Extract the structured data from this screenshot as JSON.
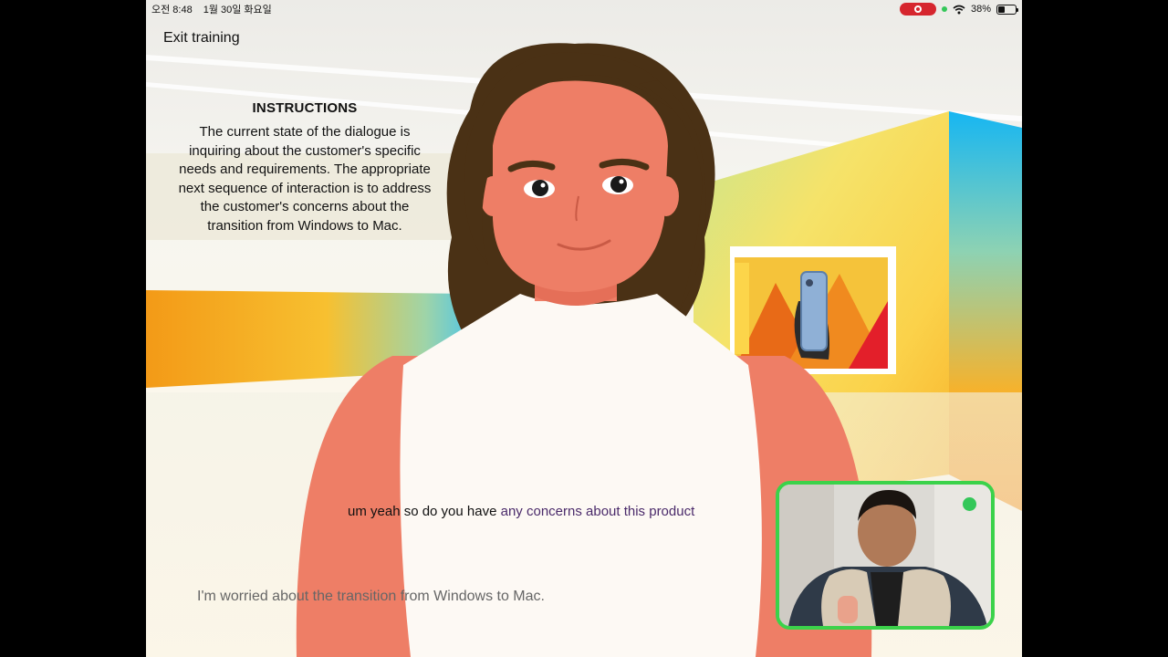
{
  "status_bar": {
    "time": "오전 8:48",
    "date": "1월 30일 화요일",
    "battery_percent": "38%",
    "battery_level": 0.38
  },
  "exit_label": "Exit training",
  "instructions": {
    "title": "INSTRUCTIONS",
    "body": "The current state of the dialogue is inquiring about the customer's specific needs and requirements. The appropriate next sequence of interaction is to address the customer's concerns about the transition from Windows to Mac."
  },
  "caption": {
    "spoken": "um yeah so do you have",
    "highlight": "any concerns about this product"
  },
  "suggested_reply": "I'm worried about the transition from Windows to Mac.",
  "colors": {
    "accent_green": "#3bd24a",
    "record_red": "#d6262e",
    "highlight_purple": "#4a2a6a"
  }
}
